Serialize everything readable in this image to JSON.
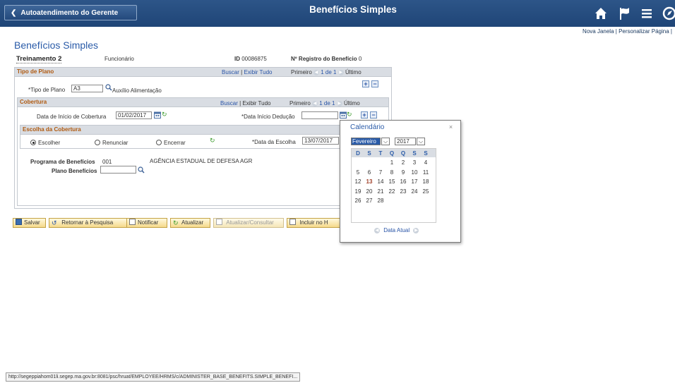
{
  "topbar": {
    "back_label": "Autoatendimento do Gerente",
    "title": "Benefícios Simples",
    "icons": [
      "home-icon",
      "flag-icon",
      "menu-icon",
      "navbar-icon"
    ]
  },
  "header_links": {
    "new_window": "Nova Janela",
    "personalize": "Personalizar Página",
    "sep": "|"
  },
  "page": {
    "title": "Benefícios Simples"
  },
  "employee": {
    "name": "Treinamento 2",
    "type": "Funcionário",
    "id_label": "ID",
    "id_value": "00086875",
    "benefit_reg_label": "Nº Registro do Benefício",
    "benefit_reg_value": "0"
  },
  "grid_nav": {
    "find": "Buscar",
    "view_all": "Exibir Tudo",
    "sep": "|",
    "first": "Primeiro",
    "range": "1 de 1",
    "last": "Último"
  },
  "plan_type": {
    "section": "Tipo de Plano",
    "label": "*Tipo de Plano",
    "value": "A3",
    "description": "Auxílio Alimentação"
  },
  "coverage": {
    "section": "Cobertura",
    "start_label": "Data de Início de Cobertura",
    "start_value": "01/02/2017",
    "deduction_label": "*Data Início Dedução",
    "deduction_value": ""
  },
  "coverage_choice": {
    "section": "Escolha da Cobertura",
    "options": [
      "Escolher",
      "Renunciar",
      "Encerrar"
    ],
    "selected": "Escolher",
    "date_label": "*Data da Escolha",
    "date_value": "13/07/2017"
  },
  "program": {
    "label": "Programa de Benefícios",
    "code": "001",
    "agency": "AGÊNCIA ESTADUAL DE DEFESA AGR",
    "plan_label": "Plano Benefícios",
    "plan_value": ""
  },
  "buttons": {
    "save": "Salvar",
    "return": "Retornar à Pesquisa",
    "notify": "Notificar",
    "refresh": "Atualizar",
    "update_view": "Atualizar/Consultar",
    "include": "Incluir no H"
  },
  "calendar": {
    "title": "Calendário",
    "close": "×",
    "month": "Fevereiro",
    "year": "2017",
    "weekdays": [
      "D",
      "S",
      "T",
      "Q",
      "Q",
      "S",
      "S"
    ],
    "weeks": [
      [
        "",
        "",
        "",
        "1",
        "2",
        "3",
        "4"
      ],
      [
        "5",
        "6",
        "7",
        "8",
        "9",
        "10",
        "11"
      ],
      [
        "12",
        "13",
        "14",
        "15",
        "16",
        "17",
        "18"
      ],
      [
        "19",
        "20",
        "21",
        "22",
        "23",
        "24",
        "25"
      ],
      [
        "26",
        "27",
        "28",
        "",
        "",
        "",
        ""
      ]
    ],
    "today": "13",
    "today_label": "Data Atual",
    "accent": "#a0402a"
  },
  "status_url": "http://segeppiahom01li.segep.ma.gov.br:8081/psc/hruat/EMPLOYEE/HRMS/c/ADMINISTER_BASE_BENEFITS.SIMPLE_BENEFI..."
}
